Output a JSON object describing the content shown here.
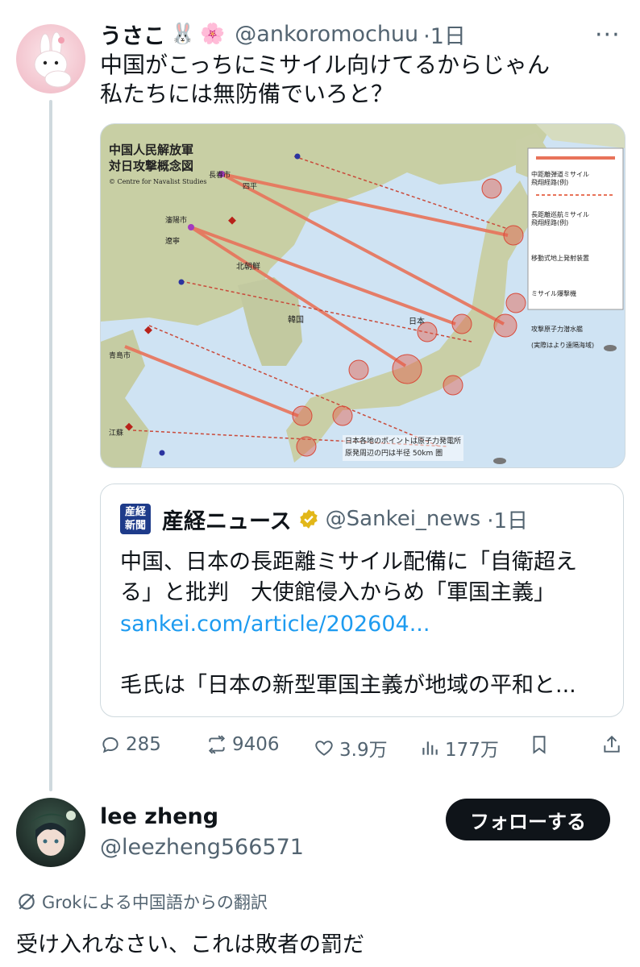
{
  "tweet": {
    "display_name": "うさこ",
    "emojis": [
      "🐰",
      "🌸"
    ],
    "handle": "@ankoromochuu",
    "time": "·1日",
    "line1": "中国がこっちにミサイル向けてるからじゃん",
    "line2": "私たちには無防備でいろと？"
  },
  "map": {
    "title1": "中国人民解放軍",
    "title2": "対日攻撃概念図",
    "credit": "© Centre for Navalist Studies",
    "legend": [
      "中距離弾道ミサイル\n飛翔経路(例)",
      "長距離巡航ミサイル\n飛翔経路(例)",
      "移動式地上発射装置",
      "ミサイル爆撃機",
      "攻撃原子力潜水艦",
      "(実際はより遠隔海域)"
    ],
    "labels": [
      "長春市",
      "四平",
      "瀋陽市",
      "遼寧",
      "北朝鮮",
      "韓国",
      "日本",
      "青島市",
      "江蘇"
    ],
    "note1": "日本各地のポイントは原子力発電所",
    "note2": "原発周辺の円は半径 50km 圏"
  },
  "quote": {
    "logo_chars": "産経新聞",
    "name": "産経ニュース",
    "handle": "@Sankei_news",
    "time": "·1日",
    "line1": "中国、日本の長距離ミサイル配備に「自衛超え",
    "line2": "る」と批判　大使館侵入からめ「軍国主義」",
    "link": "sankei.com/article/202604...",
    "line3": "毛氏は「日本の新型軍国主義が地域の平和と..."
  },
  "actions": {
    "replies": "285",
    "retweets": "9406",
    "likes": "3.9万",
    "views": "177万"
  },
  "reply": {
    "display_name": "lee zheng",
    "handle": "@leezheng566571",
    "follow_label": "フォローする",
    "translation_note": "Grokによる中国語からの翻訳",
    "text": "受け入れなさい、これは敗者の罰だ"
  },
  "colors": {
    "accent_link": "#1d9bf0",
    "secondary_text": "#536471",
    "verified_gold": "#e2b719",
    "missile_arrow": "#e8735a"
  }
}
